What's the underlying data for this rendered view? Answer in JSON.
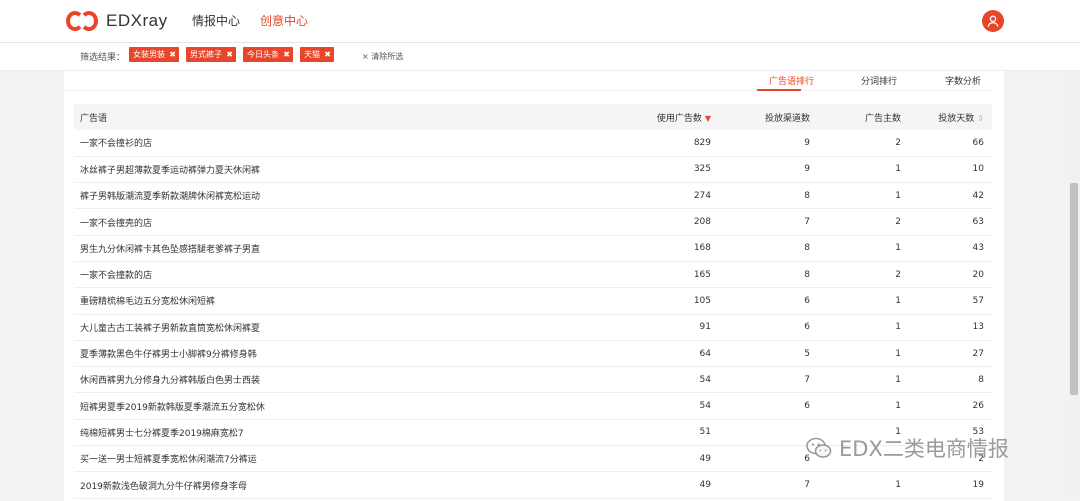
{
  "header": {
    "logo_text": "EDXray",
    "nav": [
      {
        "label": "情报中心",
        "active": false
      },
      {
        "label": "创意中心",
        "active": true
      }
    ],
    "user_icon": "user-icon"
  },
  "filters": {
    "label": "筛选结果：",
    "chips": [
      "女装男装",
      "男式裤子",
      "今日头条",
      "天猫"
    ],
    "clear_all": "清除所选"
  },
  "tabs": [
    "广告语排行",
    "分词排行",
    "字数分析"
  ],
  "table": {
    "columns": [
      "广告语",
      "使用广告数",
      "投放渠道数",
      "广告主数",
      "投放天数"
    ],
    "rows": [
      [
        "一家不会撞衫的店",
        "829",
        "9",
        "2",
        "66"
      ],
      [
        "冰丝裤子男超薄款夏季运动裤弹力夏天休闲裤",
        "325",
        "9",
        "1",
        "10"
      ],
      [
        "裤子男韩版潮流夏季新款潮牌休闲裤宽松运动",
        "274",
        "8",
        "1",
        "42"
      ],
      [
        "一家不会撞壳的店",
        "208",
        "7",
        "2",
        "63"
      ],
      [
        "男生九分休闲裤卡其色坠感搭腿老爹裤子男直",
        "168",
        "8",
        "1",
        "43"
      ],
      [
        "一家不会撞款的店",
        "165",
        "8",
        "2",
        "20"
      ],
      [
        "重磅精梳棉毛边五分宽松休闲短裤",
        "105",
        "6",
        "1",
        "57"
      ],
      [
        "大儿童古古工装裤子男新款直筒宽松休闲裤夏",
        "91",
        "6",
        "1",
        "13"
      ],
      [
        "夏季薄款黑色牛仔裤男士小脚裤9分裤修身韩",
        "64",
        "5",
        "1",
        "27"
      ],
      [
        "休闲西裤男九分修身九分裤韩版白色男士西装",
        "54",
        "7",
        "1",
        "8"
      ],
      [
        "短裤男夏季2019新款韩版夏季潮流五分宽松休",
        "54",
        "6",
        "1",
        "26"
      ],
      [
        "纯棉短裤男士七分裤夏季2019棉麻宽松7",
        "51",
        "",
        "1",
        "53"
      ],
      [
        "买一送一男士短裤夏季宽松休闲潮流7分裤运",
        "49",
        "6",
        "",
        "2"
      ],
      [
        "2019新款浅色破洞九分牛仔裤男修身李母",
        "49",
        "7",
        "1",
        "19"
      ]
    ]
  },
  "watermark": {
    "text": "EDX二类电商情报",
    "icon": "wechat-icon"
  },
  "colors": {
    "accent": "#e8452a",
    "page_bg": "#f2f2f2",
    "header_row_bg": "#f5f5f5"
  }
}
